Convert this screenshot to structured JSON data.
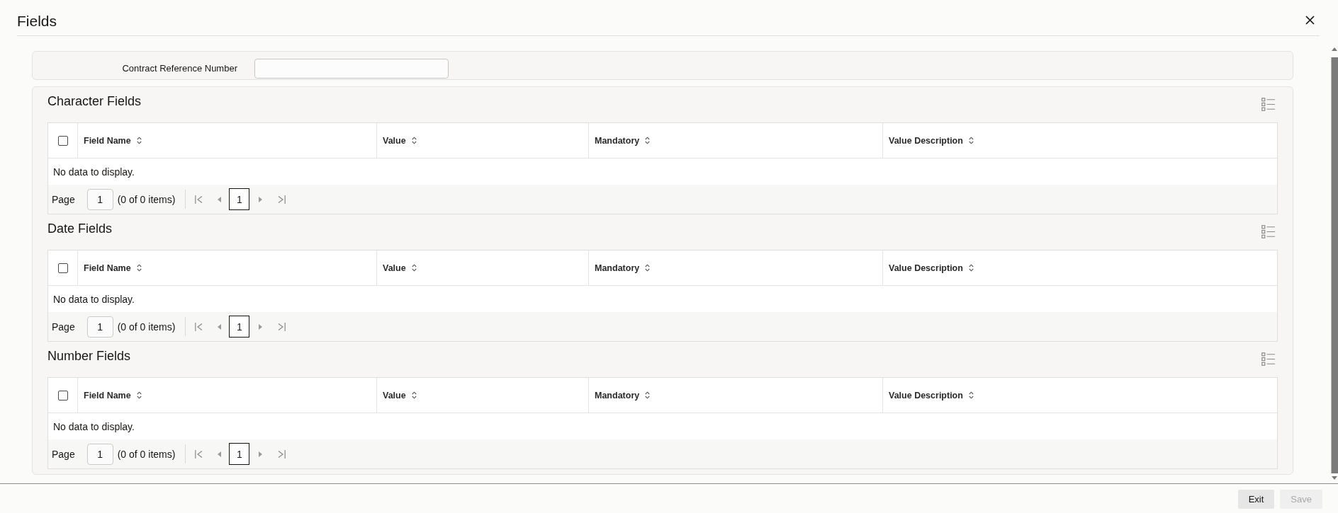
{
  "window": {
    "title": "Fields"
  },
  "contract_reference": {
    "label": "Contract Reference Number"
  },
  "sections": [
    {
      "title": "Character Fields",
      "select_all_checked": false,
      "columns": [
        "Field Name",
        "Value",
        "Mandatory",
        "Value Description"
      ],
      "empty_message": "No data to display.",
      "pagination": {
        "label": "Page",
        "page": "1",
        "summary": "(0 of 0 items)",
        "current_page": "1"
      }
    },
    {
      "title": "Date Fields",
      "select_all_checked": false,
      "columns": [
        "Field Name",
        "Value",
        "Mandatory",
        "Value Description"
      ],
      "empty_message": "No data to display.",
      "pagination": {
        "label": "Page",
        "page": "1",
        "summary": "(0 of 0 items)",
        "current_page": "1"
      }
    },
    {
      "title": "Number Fields",
      "select_all_checked": false,
      "columns": [
        "Field Name",
        "Value",
        "Mandatory",
        "Value Description"
      ],
      "empty_message": "No data to display.",
      "pagination": {
        "label": "Page",
        "page": "1",
        "summary": "(0 of 0 items)",
        "current_page": "1"
      }
    }
  ],
  "footer": {
    "buttons": [
      {
        "label": "Exit",
        "disabled": false
      },
      {
        "label": "Save",
        "disabled": true
      }
    ]
  }
}
